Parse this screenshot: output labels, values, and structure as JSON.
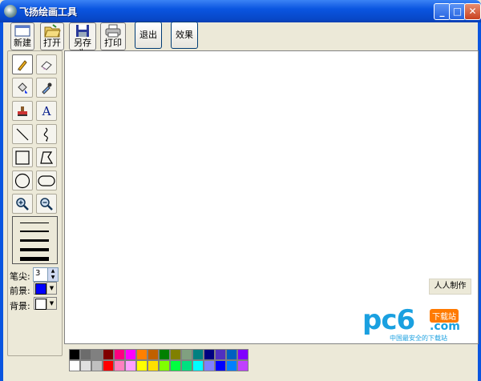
{
  "window": {
    "title": "飞扬绘画工具",
    "min_glyph": "_",
    "max_glyph": "□",
    "close_glyph": "✕"
  },
  "toolbar": {
    "new_label": "新建",
    "open_label": "打开",
    "saveas_label": "另存为",
    "print_label": "打印",
    "exit_label": "退出",
    "effects_label": "效果"
  },
  "tools": [
    "pencil-icon",
    "eraser-icon",
    "fill-bucket-icon",
    "eyedropper-icon",
    "stamp-icon",
    "text-icon",
    "line-icon",
    "curve-icon",
    "rectangle-icon",
    "polygon-icon",
    "ellipse-icon",
    "rounded-rect-icon",
    "zoom-in-icon",
    "zoom-out-icon"
  ],
  "tool_text_glyph": "A",
  "options": {
    "pen_label": "笔尖:",
    "pen_size": "3",
    "fg_label": "前景:",
    "bg_label": "背景:",
    "fg_color": "#0000ff",
    "bg_color": "#ffffff"
  },
  "credit": "人人制作",
  "watermark": {
    "brand_main": "pc6",
    "brand_com": ".com",
    "badge": "下载站",
    "tagline": "中国最安全的下载站"
  },
  "palette": {
    "row1": [
      "#000000",
      "#6c6c6c",
      "#808080",
      "#800000",
      "#ff0080",
      "#ff00ff",
      "#ff8000",
      "#c06000",
      "#008000",
      "#808000",
      "#80a080",
      "#008080",
      "#000080",
      "#5030c0",
      "#0060c0",
      "#8000ff"
    ],
    "row2": [
      "#ffffff",
      "#e0e0e0",
      "#c0c0c0",
      "#ff0000",
      "#ff80c0",
      "#ffa0ff",
      "#ffff00",
      "#ffe000",
      "#80ff00",
      "#00ff40",
      "#00e080",
      "#00ffff",
      "#8080ff",
      "#0000ff",
      "#0080ff",
      "#c040ff"
    ]
  }
}
